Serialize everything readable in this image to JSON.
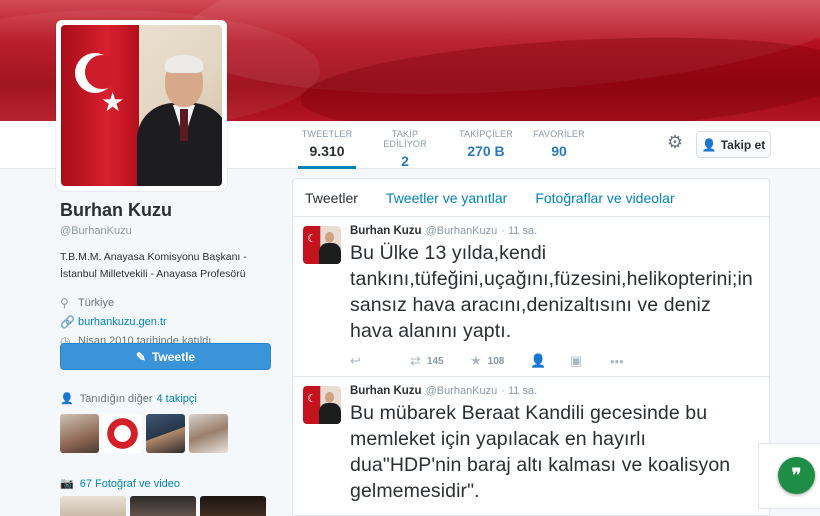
{
  "profile": {
    "name": "Burhan Kuzu",
    "handle": "@BurhanKuzu",
    "bio": "T.B.M.M. Anayasa Komisyonu Başkanı - İstanbul Milletvekili - Anayasa Profesörü",
    "location": "Türkiye",
    "website": "burhankuzu.gen.tr",
    "joined": "Nisan 2010 tarihinde katıldı"
  },
  "stats": [
    {
      "label": "TWEETLER",
      "value": "9.310"
    },
    {
      "label": "TAKİP EDİLİYOR",
      "value": "2"
    },
    {
      "label": "TAKİPÇİLER",
      "value": "270 B"
    },
    {
      "label": "FAVORİLER",
      "value": "90"
    }
  ],
  "follow_button": "Takip et",
  "tweet_button": "Tweetle",
  "sidebar": {
    "followers_title_prefix": "Tanıdığın diğer",
    "followers_title_link": "4 takipçi",
    "media_title": "67 Fotoğraf ve video"
  },
  "tabs": [
    "Tweetler",
    "Tweetler ve yanıtlar",
    "Fotoğraflar ve videolar"
  ],
  "tweets": [
    {
      "name": "Burhan Kuzu",
      "handle": "@BurhanKuzu",
      "time": "· 11 sa.",
      "text": "Bu Ülke 13 yılda,kendi tankını,tüfeğini,uçağını,füzesini,helikopterini;insansız hava aracını,denizaltısını ve deniz hava alanını yaptı.",
      "retweets": "145",
      "favorites": "108"
    },
    {
      "name": "Burhan Kuzu",
      "handle": "@BurhanKuzu",
      "time": "· 11 sa.",
      "text": "Bu mübarek Beraat Kandili gecesinde bu memleket için yapılacak en hayırlı dua\"HDP'nin baraj altı kalması ve koalisyon gelmemesidir\"."
    }
  ],
  "icons": {
    "settings": "gear-icon",
    "reply": "reply-icon",
    "retweet": "retweet-icon",
    "favorite": "star-icon",
    "follow": "add-user-icon",
    "more": "more-icon",
    "fab": "quote-icon"
  },
  "colors": {
    "link": "#0084b4",
    "tweet_button": "#3b94d9",
    "fab": "#1e8e46",
    "banner": "#b5101f"
  }
}
